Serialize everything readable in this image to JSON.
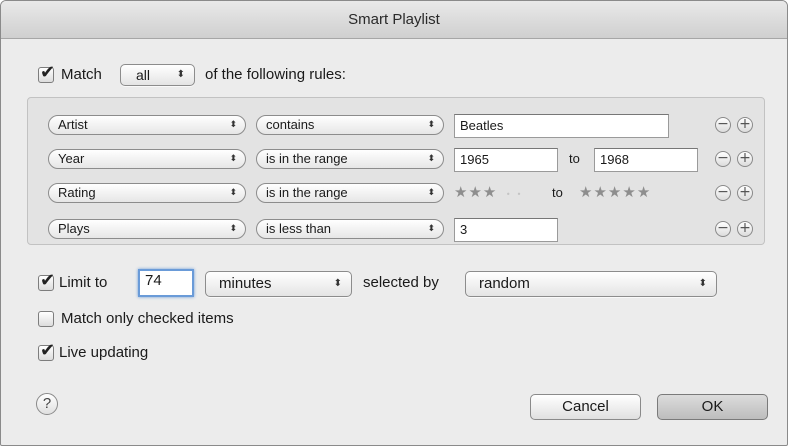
{
  "window": {
    "title": "Smart Playlist"
  },
  "match": {
    "checked": true,
    "label_before": "Match",
    "mode": "all",
    "label_after": "of the following rules:"
  },
  "rules": [
    {
      "field": "Artist",
      "operator": "contains",
      "value": "Beatles"
    },
    {
      "field": "Year",
      "operator": "is in the range",
      "from": "1965",
      "to_label": "to",
      "to": "1968"
    },
    {
      "field": "Rating",
      "operator": "is in the range",
      "from_stars": 3,
      "to_label": "to",
      "to_stars": 5
    },
    {
      "field": "Plays",
      "operator": "is less than",
      "value": "3"
    }
  ],
  "limit": {
    "checked": true,
    "label": "Limit to",
    "value": "74",
    "unit": "minutes",
    "selected_by_label": "selected by",
    "selected_by": "random"
  },
  "options": {
    "match_checked": {
      "checked": false,
      "label": "Match only checked items"
    },
    "live_updating": {
      "checked": true,
      "label": "Live updating"
    }
  },
  "buttons": {
    "help": "?",
    "cancel": "Cancel",
    "ok": "OK"
  },
  "icons": {
    "remove": "minus-circle-icon",
    "add": "plus-circle-icon",
    "popup_arrows": "up-down-arrows-icon",
    "checkmark": "checkmark-icon"
  }
}
